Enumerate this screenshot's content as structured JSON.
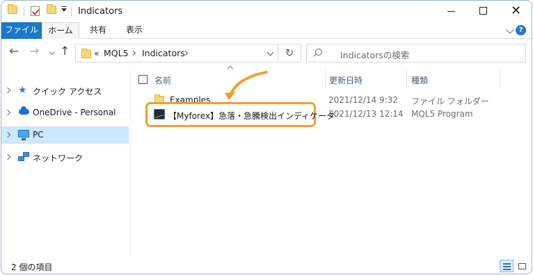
{
  "window": {
    "title": "Indicators"
  },
  "ribbon": {
    "file": "ファイル",
    "home": "ホーム",
    "share": "共有",
    "view": "表示",
    "help": "?"
  },
  "address": {
    "overflow": "«",
    "crumbs": [
      "MQL5",
      "Indicators"
    ],
    "refresh": "↻",
    "search_placeholder": "Indicatorsの検索"
  },
  "nav_glyphs": {
    "back": "←",
    "forward": "→",
    "up": "↑"
  },
  "nav_pane": {
    "items": [
      {
        "label": "クイック アクセス",
        "icon": "quick-access-star-icon"
      },
      {
        "label": "OneDrive - Personal",
        "icon": "onedrive-cloud-icon"
      },
      {
        "label": "PC",
        "icon": "pc-icon",
        "selected": true
      },
      {
        "label": "ネットワーク",
        "icon": "network-icon"
      }
    ]
  },
  "columns": {
    "name": "名前",
    "date": "更新日時",
    "type": "種類"
  },
  "files": [
    {
      "name": "Examples",
      "date": "2021/12/14 9:32",
      "type": "ファイル フォルダー",
      "icon": "folder-icon"
    },
    {
      "name": "【Myforex】急落・急騰検出インディケータ",
      "date": "2021/12/13 12:14",
      "type": "MQL5 Program",
      "icon": "mql5-program-icon",
      "highlighted": true
    }
  ],
  "status": {
    "count": "2 個の項目"
  },
  "colors": {
    "accent": "#1979ca",
    "highlight": "#f0a033",
    "selection": "#cce8ff"
  }
}
